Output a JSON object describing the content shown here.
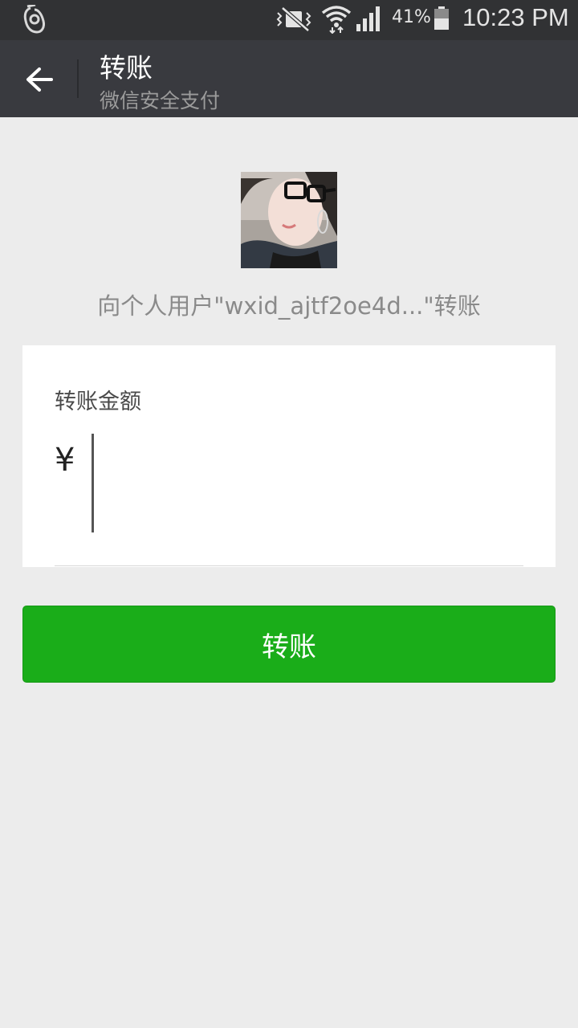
{
  "status_bar": {
    "battery_percent": "41%",
    "time": "10:23 PM",
    "icons": [
      "notification-icon",
      "mute-icon",
      "wifi-icon",
      "signal-icon",
      "battery-icon"
    ]
  },
  "action_bar": {
    "title": "转账",
    "subtitle": "微信安全支付",
    "back_icon": "back-arrow-icon"
  },
  "recipient": {
    "text": "向个人用户\"wxid_ajtf2oe4d...\"转账"
  },
  "amount_card": {
    "label": "转账金额",
    "currency_symbol": "¥",
    "input_value": ""
  },
  "transfer_button": {
    "label": "转账"
  },
  "colors": {
    "status_bar_bg": "#313234",
    "action_bar_bg": "#393a3f",
    "page_bg": "#ececec",
    "primary_green": "#1aad19"
  }
}
